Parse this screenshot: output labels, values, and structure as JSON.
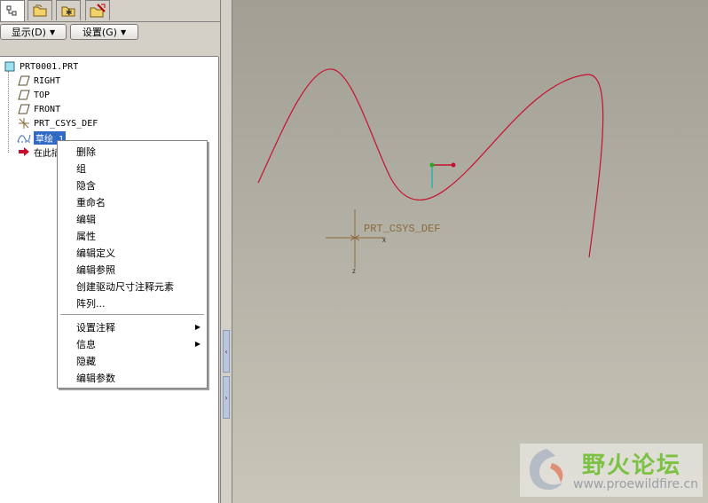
{
  "toolbar": {
    "show_label": "显示(D)",
    "settings_label": "设置(G)"
  },
  "tree": {
    "root": "PRT0001.PRT",
    "items": [
      {
        "label": "RIGHT",
        "icon": "datum-plane-icon"
      },
      {
        "label": "TOP",
        "icon": "datum-plane-icon"
      },
      {
        "label": "FRONT",
        "icon": "datum-plane-icon"
      },
      {
        "label": "PRT_CSYS_DEF",
        "icon": "coordinate-system-icon"
      },
      {
        "label": "草绘 1",
        "icon": "sketch-icon",
        "selected": true
      },
      {
        "label": "在此插入",
        "icon": "insert-here-arrow-icon"
      }
    ]
  },
  "context_menu": {
    "items": [
      "删除",
      "组",
      "隐含",
      "重命名",
      "编辑",
      "属性",
      "编辑定义",
      "编辑参照",
      "创建驱动尺寸注释元素",
      "阵列..."
    ],
    "items2": [
      {
        "label": "设置注释",
        "submenu": true
      },
      {
        "label": "信息",
        "submenu": true
      },
      {
        "label": "隐藏",
        "submenu": false
      },
      {
        "label": "编辑参数",
        "submenu": false
      }
    ]
  },
  "graphics": {
    "csys_label": "PRT_CSYS_DEF",
    "axis_x": "x",
    "axis_z": "z",
    "curve_color": "#c8102e",
    "csys_color": "#8a6a3a"
  },
  "watermark": {
    "title": "野火论坛",
    "url": "www.proewildfire.cn"
  },
  "colors": {
    "selection": "#316ac5",
    "panel": "#d4d0c8"
  }
}
